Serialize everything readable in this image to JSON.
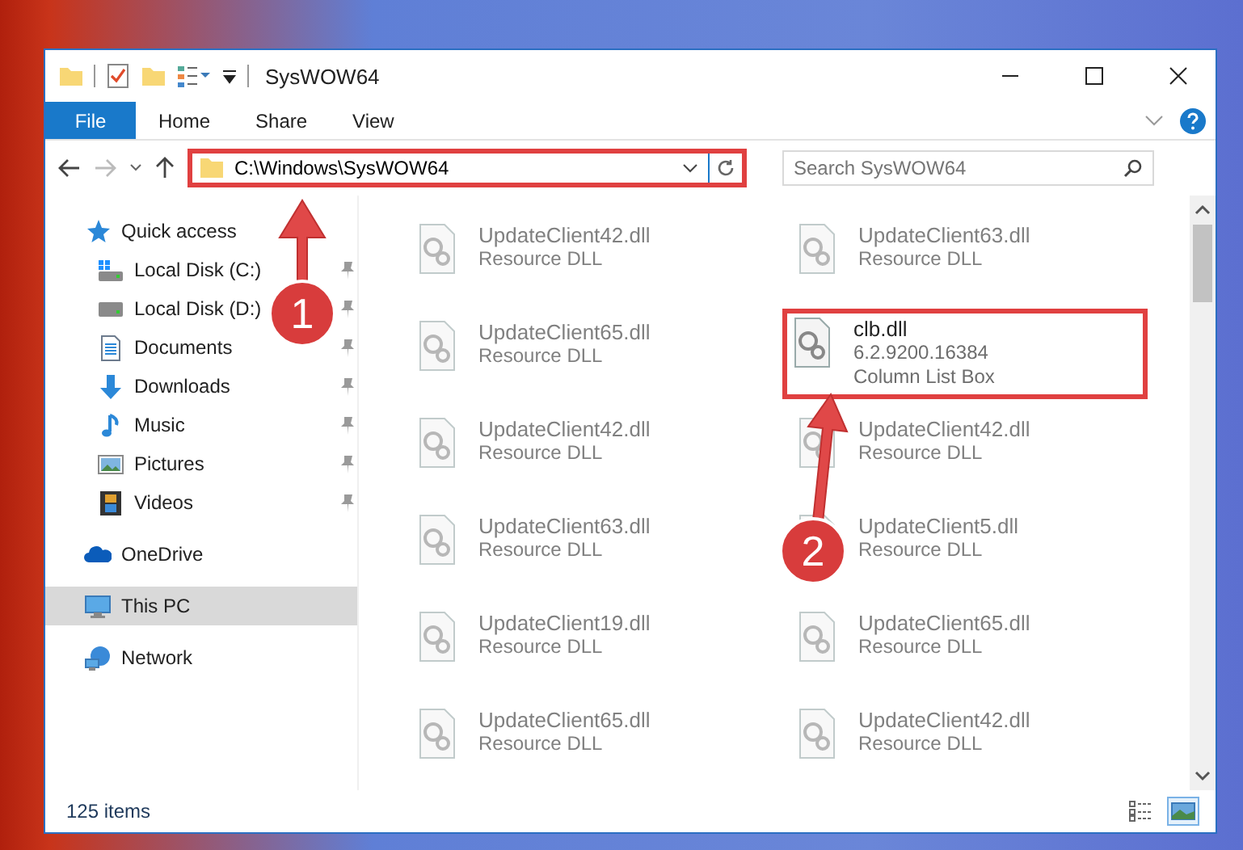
{
  "window": {
    "title": "SysWOW64"
  },
  "ribbon_tabs": [
    {
      "label": "File",
      "kind": "file-menu"
    },
    {
      "label": "Home",
      "kind": "tab"
    },
    {
      "label": "Share",
      "kind": "tab"
    },
    {
      "label": "View",
      "kind": "tab"
    }
  ],
  "address_bar": {
    "path": "C:\\Windows\\SysWOW64",
    "highlighted": true
  },
  "search": {
    "placeholder": "Search SysWOW64"
  },
  "sidebar": {
    "items": [
      {
        "label": "Quick access",
        "kind": "star",
        "selected": false,
        "children": [
          {
            "label": "Local Disk (C:)",
            "kind": "system-drive",
            "pinned": true,
            "selected": false
          },
          {
            "label": "Local Disk (D:)",
            "kind": "drive",
            "pinned": true,
            "selected": false
          },
          {
            "label": "Documents",
            "kind": "documents",
            "pinned": true,
            "selected": false
          },
          {
            "label": "Downloads",
            "kind": "downloads",
            "pinned": true,
            "selected": false
          },
          {
            "label": "Music",
            "kind": "music",
            "pinned": true,
            "selected": false
          },
          {
            "label": "Pictures",
            "kind": "pictures",
            "pinned": true,
            "selected": false
          },
          {
            "label": "Videos",
            "kind": "videos",
            "pinned": true,
            "selected": false
          }
        ]
      },
      {
        "label": "OneDrive",
        "kind": "cloud",
        "selected": false
      },
      {
        "label": "This PC",
        "kind": "computer",
        "selected": true
      },
      {
        "label": "Network",
        "kind": "network",
        "selected": false
      }
    ]
  },
  "files": [
    {
      "name": "UpdateClient42.dll",
      "details": [
        "Resource DLL"
      ],
      "highlighted": false
    },
    {
      "name": "UpdateClient63.dll",
      "details": [
        "Resource DLL"
      ],
      "highlighted": false
    },
    {
      "name": "UpdateClient65.dll",
      "details": [
        "Resource DLL"
      ],
      "highlighted": false
    },
    {
      "name": "clb.dll",
      "details": [
        "6.2.9200.16384",
        "Column List Box"
      ],
      "highlighted": true
    },
    {
      "name": "UpdateClient42.dll",
      "details": [
        "Resource DLL"
      ],
      "highlighted": false
    },
    {
      "name": "UpdateClient42.dll",
      "details": [
        "Resource DLL"
      ],
      "highlighted": false
    },
    {
      "name": "UpdateClient63.dll",
      "details": [
        "Resource DLL"
      ],
      "highlighted": false
    },
    {
      "name": "UpdateClient5.dll",
      "details": [
        "Resource DLL"
      ],
      "highlighted": false
    },
    {
      "name": "UpdateClient19.dll",
      "details": [
        "Resource DLL"
      ],
      "highlighted": false
    },
    {
      "name": "UpdateClient65.dll",
      "details": [
        "Resource DLL"
      ],
      "highlighted": false
    },
    {
      "name": "UpdateClient65.dll",
      "details": [
        "Resource DLL"
      ],
      "highlighted": false
    },
    {
      "name": "UpdateClient42.dll",
      "details": [
        "Resource DLL"
      ],
      "highlighted": false
    }
  ],
  "status_bar": {
    "item_count": "125 items",
    "view_buttons": [
      {
        "kind": "details",
        "selected": false
      },
      {
        "kind": "large-icons",
        "selected": true
      }
    ]
  },
  "annotations": [
    {
      "number": "1"
    },
    {
      "number": "2"
    }
  ]
}
